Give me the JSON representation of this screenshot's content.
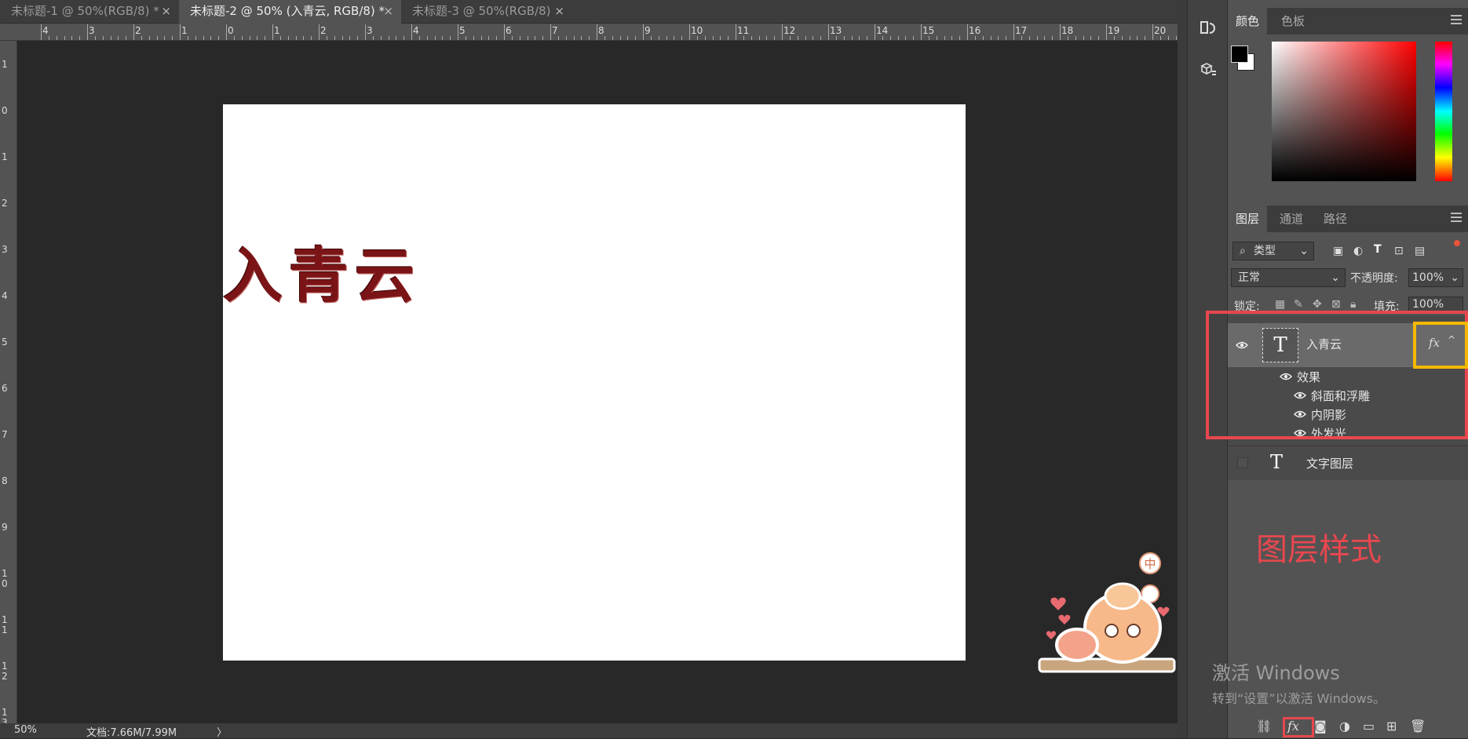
{
  "tabs": [
    {
      "label": "未标题-1 @ 50%(RGB/8) *",
      "close": "×"
    },
    {
      "label": "未标题-2 @ 50% (入青云, RGB/8) *",
      "close": "×"
    },
    {
      "label": "未标题-3 @ 50%(RGB/8)",
      "close": "×"
    }
  ],
  "ruler_top": [
    "4",
    "3",
    "2",
    "1",
    "0",
    "1",
    "2",
    "3",
    "4",
    "5",
    "6",
    "7",
    "8",
    "9",
    "10",
    "11",
    "12",
    "13",
    "14",
    "15",
    "16",
    "17",
    "18",
    "19",
    "20"
  ],
  "ruler_left": [
    "1",
    "0",
    "1",
    "2",
    "3",
    "4",
    "5",
    "6",
    "7",
    "8",
    "9",
    "1 0",
    "1 1",
    "1 2",
    "1 3"
  ],
  "canvas": {
    "text": "入青云",
    "text_color": "#7b1416"
  },
  "status": {
    "zoom": "50%",
    "doc_info": "文档:7.66M/7.99M",
    "arrow": "〉"
  },
  "color_panel": {
    "tabs": [
      "颜色",
      "色板"
    ],
    "foreground": "#000000",
    "background": "#ffffff"
  },
  "layers_panel": {
    "tabs": [
      "图层",
      "通道",
      "路径"
    ],
    "filter_label": "类型",
    "blend_mode": "正常",
    "opacity_label": "不透明度:",
    "opacity_value": "100%",
    "lock_label": "锁定:",
    "fill_label": "填充:",
    "fill_value": "100%",
    "layers": [
      {
        "name": "入青云",
        "fx": "fx",
        "effects_label": "效果",
        "effects": [
          "斜面和浮雕",
          "内阴影",
          "外发光"
        ]
      },
      {
        "name": "文字图层"
      }
    ],
    "footer_fx": "fx"
  },
  "annotation": {
    "label": "图层样式",
    "color": "#e8474f",
    "highlight_yellow": "#f5b800"
  },
  "activate_windows": {
    "title": "激活 Windows",
    "subtitle": "转到“设置”以激活 Windows。"
  },
  "sticker_badge": "中"
}
